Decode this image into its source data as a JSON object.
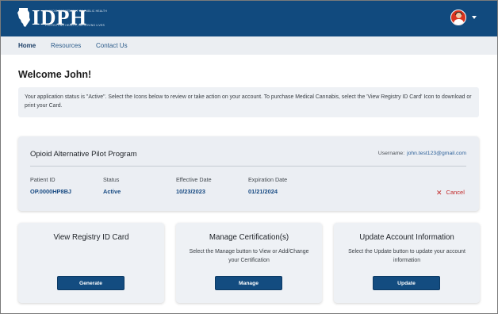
{
  "header": {
    "logo_text": "IDPH",
    "logo_tagline_top": "ILLINOIS DEPARTMENT OF PUBLIC HEALTH",
    "logo_tagline_bottom": "PROTECTING HEALTH, IMPROVING LIVES",
    "brand_color": "#114a7e"
  },
  "nav": {
    "items": [
      {
        "label": "Home",
        "active": true
      },
      {
        "label": "Resources",
        "active": false
      },
      {
        "label": "Contact Us",
        "active": false
      }
    ]
  },
  "welcome": "Welcome John!",
  "notice": "Your application status is \"Active\". Select the Icons below to review or take action on your account. To purchase Medical Cannabis, select the 'View Registry ID Card' Icon to download or print your Card.",
  "program": {
    "title": "Opioid Alternative Pilot Program",
    "username_label": "Username:",
    "username_value": "john.test123@gmail.com",
    "fields": [
      {
        "label": "Patient ID",
        "value": "OP.0000HP8BJ"
      },
      {
        "label": "Status",
        "value": "Active"
      },
      {
        "label": "Effective Date",
        "value": "10/23/2023"
      },
      {
        "label": "Expiration Date",
        "value": "01/21/2024"
      }
    ],
    "cancel_label": "Cancel",
    "cancel_icon": "close-icon"
  },
  "tiles": [
    {
      "title": "View Registry ID Card",
      "description": "",
      "button": "Generate"
    },
    {
      "title": "Manage Certification(s)",
      "description": "Select the Manage button to View or Add/Change  your Certification",
      "button": "Manage"
    },
    {
      "title": "Update Account Information",
      "description": "Select the Update button to update your account information",
      "button": "Update"
    }
  ]
}
